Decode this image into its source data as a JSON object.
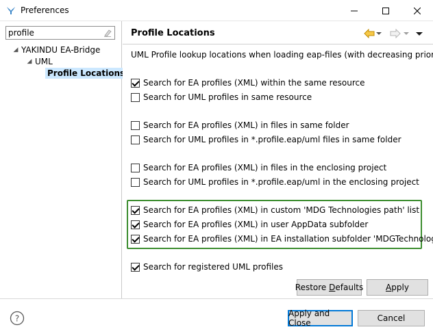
{
  "window": {
    "title": "Preferences",
    "icon": "eclipse-app-icon",
    "controls": [
      "minimize-icon",
      "maximize-icon",
      "close-icon"
    ]
  },
  "sidebar": {
    "filter": {
      "value": "profile",
      "icon": "clear-filter-icon"
    },
    "tree": [
      {
        "label": "YAKINDU EA-Bridge",
        "expanded": true,
        "level": 0
      },
      {
        "label": "UML",
        "expanded": true,
        "level": 1
      },
      {
        "label": "Profile Locations",
        "selected": true,
        "level": 2
      }
    ]
  },
  "page": {
    "title": "Profile Locations",
    "nav_icons": [
      "back-icon",
      "back-menu-icon",
      "forward-icon",
      "forward-menu-icon",
      "view-menu-icon"
    ],
    "description": "UML Profile lookup locations when loading eap-files (with decreasing priority)",
    "options": [
      {
        "label": "Search for EA profiles (XML) within the same resource",
        "checked": true
      },
      {
        "label": "Search for UML profiles in same resource",
        "checked": false
      },
      {
        "label": "Search for EA profiles (XML) in files in same folder",
        "checked": false
      },
      {
        "label": "Search for UML profiles in *.profile.eap/uml files in same folder",
        "checked": false
      },
      {
        "label": "Search for EA profiles (XML) in files in the enclosing project",
        "checked": false
      },
      {
        "label": "Search for UML profiles in *.profile.eap/uml in the enclosing project",
        "checked": false
      },
      {
        "label": "Search for EA profiles (XML) in custom 'MDG Technologies path' list",
        "checked": true
      },
      {
        "label": "Search for EA profiles (XML) in user AppData subfolder",
        "checked": true
      },
      {
        "label": "Search for EA profiles (XML) in EA installation subfolder 'MDGTechnologies'",
        "checked": true
      },
      {
        "label": "Search for registered UML profiles",
        "checked": true
      }
    ],
    "restore_defaults_pre": "Restore ",
    "restore_defaults_u": "D",
    "restore_defaults_post": "efaults",
    "apply_u": "A",
    "apply_post": "pply"
  },
  "footer": {
    "help_icon": "help-icon",
    "apply_and_close": "Apply and Close",
    "cancel": "Cancel"
  },
  "colors": {
    "highlight_border": "#3c8d2f",
    "selection_bg": "#cce8ff",
    "default_button_border": "#0078d7",
    "nav_back_arrow": "#f0b400"
  }
}
